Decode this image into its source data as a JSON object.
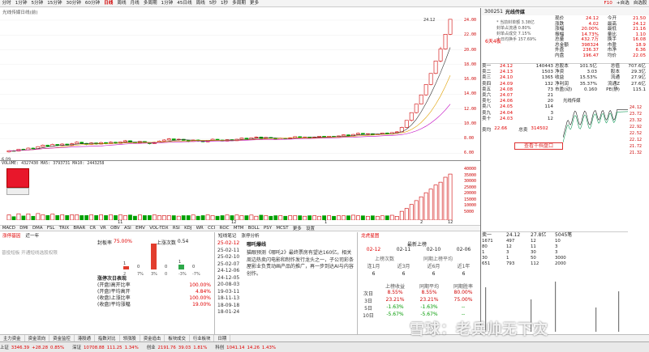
{
  "toolbar": {
    "periods": [
      "分时",
      "1分钟",
      "5分钟",
      "15分钟",
      "30分钟",
      "60分钟",
      "日线",
      "周线",
      "月线",
      "多周期",
      "1分钟",
      "45日线",
      "周线",
      "5秒",
      "1秒",
      "多周期",
      "更多"
    ],
    "active_index": 6,
    "right_items": [
      "F10",
      "+自选",
      "自选股"
    ]
  },
  "stock_title": "光线传媒日线(前)",
  "price_axis": [
    "24.00",
    "22.00",
    "20.00",
    "18.00",
    "16.00",
    "14.00",
    "12.00",
    "10.00",
    "8.00",
    "6.00"
  ],
  "candles": [
    {
      "o": 6.18,
      "c": 6.35,
      "h": 6.4,
      "l": 6.1
    },
    {
      "o": 6.35,
      "c": 6.3,
      "h": 6.45,
      "l": 6.22
    },
    {
      "o": 6.3,
      "c": 6.55,
      "h": 6.6,
      "l": 6.25
    },
    {
      "o": 6.55,
      "c": 6.45,
      "h": 6.62,
      "l": 6.38
    },
    {
      "o": 6.45,
      "c": 6.7,
      "h": 6.78,
      "l": 6.4
    },
    {
      "o": 6.7,
      "c": 6.62,
      "h": 6.8,
      "l": 6.5
    },
    {
      "o": 6.62,
      "c": 6.9,
      "h": 6.95,
      "l": 6.58
    },
    {
      "o": 6.9,
      "c": 7.1,
      "h": 7.2,
      "l": 6.85
    },
    {
      "o": 7.1,
      "c": 6.95,
      "h": 7.15,
      "l": 6.88
    },
    {
      "o": 6.95,
      "c": 7.2,
      "h": 7.3,
      "l": 6.9
    },
    {
      "o": 7.2,
      "c": 7.05,
      "h": 7.25,
      "l": 6.95
    },
    {
      "o": 7.05,
      "c": 7.25,
      "h": 7.35,
      "l": 7.0
    },
    {
      "o": 7.25,
      "c": 7.1,
      "h": 7.3,
      "l": 7.02
    },
    {
      "o": 7.1,
      "c": 7.3,
      "h": 7.4,
      "l": 7.05
    },
    {
      "o": 7.3,
      "c": 7.5,
      "h": 7.6,
      "l": 7.25
    },
    {
      "o": 7.5,
      "c": 7.35,
      "h": 7.55,
      "l": 7.3
    },
    {
      "o": 7.35,
      "c": 7.2,
      "h": 7.4,
      "l": 7.1
    },
    {
      "o": 7.2,
      "c": 7.4,
      "h": 7.48,
      "l": 7.15
    },
    {
      "o": 7.4,
      "c": 7.25,
      "h": 7.45,
      "l": 7.15
    },
    {
      "o": 7.25,
      "c": 7.45,
      "h": 7.55,
      "l": 7.2
    },
    {
      "o": 7.45,
      "c": 7.3,
      "h": 7.5,
      "l": 7.22
    },
    {
      "o": 7.3,
      "c": 7.5,
      "h": 7.6,
      "l": 7.25
    },
    {
      "o": 7.5,
      "c": 7.35,
      "h": 7.55,
      "l": 7.28
    },
    {
      "o": 7.35,
      "c": 7.55,
      "h": 7.6,
      "l": 7.3
    },
    {
      "o": 7.55,
      "c": 7.7,
      "h": 7.8,
      "l": 7.5
    },
    {
      "o": 7.7,
      "c": 7.5,
      "h": 7.75,
      "l": 7.45
    },
    {
      "o": 7.5,
      "c": 7.4,
      "h": 7.55,
      "l": 7.3
    },
    {
      "o": 7.4,
      "c": 7.6,
      "h": 7.65,
      "l": 7.35
    },
    {
      "o": 7.6,
      "c": 7.45,
      "h": 7.65,
      "l": 7.4
    },
    {
      "o": 7.45,
      "c": 7.3,
      "h": 7.5,
      "l": 7.2
    },
    {
      "o": 7.3,
      "c": 7.5,
      "h": 7.55,
      "l": 7.25
    },
    {
      "o": 7.5,
      "c": 7.65,
      "h": 7.75,
      "l": 7.45
    },
    {
      "o": 7.65,
      "c": 7.8,
      "h": 7.9,
      "l": 7.6
    },
    {
      "o": 7.8,
      "c": 7.95,
      "h": 8.05,
      "l": 7.75
    },
    {
      "o": 7.95,
      "c": 7.8,
      "h": 8.0,
      "l": 7.7
    },
    {
      "o": 7.8,
      "c": 7.9,
      "h": 7.98,
      "l": 7.72
    },
    {
      "o": 7.9,
      "c": 7.75,
      "h": 7.95,
      "l": 7.7
    },
    {
      "o": 7.75,
      "c": 7.6,
      "h": 7.8,
      "l": 7.5
    },
    {
      "o": 7.6,
      "c": 7.8,
      "h": 7.85,
      "l": 7.55
    },
    {
      "o": 7.8,
      "c": 7.7,
      "h": 7.88,
      "l": 7.62
    },
    {
      "o": 7.7,
      "c": 7.55,
      "h": 7.72,
      "l": 7.48
    },
    {
      "o": 7.55,
      "c": 7.75,
      "h": 7.8,
      "l": 7.5
    },
    {
      "o": 7.75,
      "c": 7.9,
      "h": 8.0,
      "l": 7.7
    },
    {
      "o": 7.9,
      "c": 7.8,
      "h": 7.95,
      "l": 7.72
    },
    {
      "o": 7.8,
      "c": 7.65,
      "h": 7.85,
      "l": 7.6
    },
    {
      "o": 7.65,
      "c": 7.85,
      "h": 7.9,
      "l": 7.6
    },
    {
      "o": 7.85,
      "c": 7.7,
      "h": 7.9,
      "l": 7.65
    },
    {
      "o": 7.7,
      "c": 7.9,
      "h": 7.95,
      "l": 7.68
    },
    {
      "o": 7.9,
      "c": 8.05,
      "h": 8.1,
      "l": 7.85
    },
    {
      "o": 8.05,
      "c": 7.9,
      "h": 8.1,
      "l": 7.85
    },
    {
      "o": 7.9,
      "c": 8.1,
      "h": 8.15,
      "l": 7.85
    },
    {
      "o": 8.1,
      "c": 8.2,
      "h": 8.3,
      "l": 8.05
    },
    {
      "o": 8.2,
      "c": 8.0,
      "h": 8.25,
      "l": 7.95
    },
    {
      "o": 8.0,
      "c": 8.15,
      "h": 8.2,
      "l": 7.95
    },
    {
      "o": 8.15,
      "c": 8.05,
      "h": 8.2,
      "l": 7.98
    },
    {
      "o": 8.05,
      "c": 7.9,
      "h": 8.1,
      "l": 7.85
    },
    {
      "o": 7.9,
      "c": 8.05,
      "h": 8.1,
      "l": 7.85
    },
    {
      "o": 8.05,
      "c": 7.95,
      "h": 8.1,
      "l": 7.9
    },
    {
      "o": 7.95,
      "c": 8.1,
      "h": 8.15,
      "l": 7.9
    },
    {
      "o": 8.1,
      "c": 8.25,
      "h": 8.3,
      "l": 8.05
    },
    {
      "o": 8.25,
      "c": 8.1,
      "h": 8.3,
      "l": 8.05
    },
    {
      "o": 8.1,
      "c": 8.2,
      "h": 8.25,
      "l": 8.05
    },
    {
      "o": 8.2,
      "c": 8.05,
      "h": 8.22,
      "l": 8.0
    },
    {
      "o": 8.05,
      "c": 8.2,
      "h": 8.25,
      "l": 8.0
    },
    {
      "o": 8.2,
      "c": 8.3,
      "h": 8.35,
      "l": 8.15
    },
    {
      "o": 8.3,
      "c": 8.15,
      "h": 8.35,
      "l": 8.1
    },
    {
      "o": 8.15,
      "c": 8.3,
      "h": 8.35,
      "l": 8.1
    },
    {
      "o": 8.3,
      "c": 8.2,
      "h": 8.35,
      "l": 8.15
    },
    {
      "o": 8.2,
      "c": 8.35,
      "h": 8.4,
      "l": 8.15
    },
    {
      "o": 8.35,
      "c": 8.5,
      "h": 8.55,
      "l": 8.3
    },
    {
      "o": 8.5,
      "c": 8.35,
      "h": 8.55,
      "l": 8.3
    },
    {
      "o": 8.35,
      "c": 8.55,
      "h": 8.6,
      "l": 8.3
    },
    {
      "o": 8.55,
      "c": 8.7,
      "h": 8.8,
      "l": 8.5
    },
    {
      "o": 8.7,
      "c": 8.55,
      "h": 8.75,
      "l": 8.5
    },
    {
      "o": 8.55,
      "c": 8.65,
      "h": 8.7,
      "l": 8.45
    },
    {
      "o": 8.65,
      "c": 8.5,
      "h": 8.7,
      "l": 8.45
    },
    {
      "o": 8.5,
      "c": 8.6,
      "h": 8.65,
      "l": 8.45
    },
    {
      "o": 8.6,
      "c": 8.75,
      "h": 8.8,
      "l": 8.55
    },
    {
      "o": 8.75,
      "c": 8.6,
      "h": 8.8,
      "l": 8.55
    },
    {
      "o": 8.6,
      "c": 8.8,
      "h": 8.85,
      "l": 8.55
    },
    {
      "o": 8.8,
      "c": 8.9,
      "h": 9.0,
      "l": 8.75
    },
    {
      "o": 8.9,
      "c": 9.5,
      "h": 9.6,
      "l": 8.85
    },
    {
      "o": 9.5,
      "c": 10.45,
      "h": 10.45,
      "l": 9.4
    },
    {
      "o": 10.45,
      "c": 11.5,
      "h": 11.5,
      "l": 10.3
    },
    {
      "o": 11.5,
      "c": 12.65,
      "h": 12.65,
      "l": 11.4
    },
    {
      "o": 12.65,
      "c": 13.9,
      "h": 13.9,
      "l": 12.6
    },
    {
      "o": 13.9,
      "c": 15.3,
      "h": 15.3,
      "l": 13.8
    },
    {
      "o": 15.3,
      "c": 16.8,
      "h": 16.8,
      "l": 15.2
    },
    {
      "o": 16.8,
      "c": 18.48,
      "h": 18.48,
      "l": 16.7
    },
    {
      "o": 18.48,
      "c": 20.1,
      "h": 20.4,
      "l": 18.3
    },
    {
      "o": 20.1,
      "c": 22.1,
      "h": 22.1,
      "l": 20.0
    },
    {
      "o": 22.1,
      "c": 24.12,
      "h": 24.12,
      "l": 22.0
    }
  ],
  "chart_marks": {
    "low_label": "6.09",
    "high_label": "24.12"
  },
  "volume": {
    "header": "VOLUME: 4327430  MA5: 3793731  MA10: 2443258",
    "axis": [
      "40000",
      "35000",
      "30000",
      "25000",
      "20000",
      "15000",
      "10000",
      "5000"
    ],
    "month_labels": [
      "11",
      "12",
      "1",
      "2",
      "12"
    ]
  },
  "indicators": [
    "MACD",
    "DMI",
    "DMA",
    "FSL",
    "TRIX",
    "BRAR",
    "CR",
    "VR",
    "OBV",
    "ASI",
    "EMV",
    "VOL-TDX",
    "RSI",
    "KDJ",
    "WR",
    "CCI",
    "ROC",
    "MTM",
    "BOLL",
    "PSY",
    "MCST",
    "更多",
    "设置"
  ],
  "zt_panel": {
    "tabs": [
      "涨停基因",
      "近一年"
    ],
    "ratio_label": "封板率",
    "ratio": "75.00%",
    "up_days_label": "上涨次数",
    "up_days": "0.54",
    "bars_top": [
      "1",
      "0",
      "91",
      "0",
      "1",
      "0"
    ],
    "bars_pct": [
      "2",
      "7%",
      "3%",
      "0",
      "-3%",
      "-7%"
    ],
    "table_title": "涨停次日表现",
    "rows": [
      [
        "(开盘)高开比率",
        "100.00%"
      ],
      [
        "(开盘)平均高开",
        "4.84%"
      ],
      [
        "(收盘)上涨比率",
        "100.00%"
      ],
      [
        "(收盘)平均涨幅",
        "19.00%"
      ]
    ],
    "hint": "普投短板 开通短线选股权限"
  },
  "news": {
    "tabs": [
      "短线笔记",
      "涨停分析"
    ],
    "dates": [
      "25-02-12",
      "25-02-11",
      "25-02-10",
      "25-02-07",
      "24-12-06",
      "24-12-05",
      "20-08-03",
      "19-03-11",
      "18-11-13",
      "18-09-18",
      "18-01-24"
    ],
    "title": "哪吒爆线",
    "body": "猫眼预测《哪吒2》最终票房有望达160亿。相关周边热卖闪电影和制作发行龙头之一，子公司彩条屋影业负责动画产品的推广，再一步到达AI与内容创作。"
  },
  "fs_panel": {
    "tabs": [
      "龙虎星图"
    ],
    "title": "最新上榜",
    "dates": [
      "02-12",
      "02-11",
      "02-10",
      "02-06"
    ],
    "sub_headers": [
      "上榜次数",
      "同期上榜平均"
    ],
    "counts_head": [
      "连1月",
      "近3月",
      "近6月",
      "近1年"
    ],
    "counts": [
      "6",
      "6",
      "6",
      "6"
    ],
    "table_head": [
      "",
      "上榜收益",
      "同期平均",
      "同期胜率"
    ],
    "rows": [
      [
        "次日",
        "8.55%",
        "8.55%",
        "80.00%"
      ],
      [
        "3日",
        "23.21%",
        "23.21%",
        "75.00%"
      ],
      [
        "5日",
        "-1.63%",
        "-1.63%",
        "--"
      ],
      [
        "10日",
        "-5.67%",
        "-5.67%",
        "--"
      ]
    ]
  },
  "quote": {
    "code": "300251",
    "name": "光线传媒",
    "left": [
      [
        "现价",
        "24.12"
      ],
      [
        "涨跌",
        "4.02"
      ],
      [
        "涨幅",
        "20.00%"
      ],
      [
        "振幅",
        "14.73%"
      ],
      [
        "总量",
        "432.7万"
      ],
      [
        "总金额",
        "398324"
      ],
      [
        "外盘",
        "236.37"
      ],
      [
        "内盘",
        "196.47"
      ]
    ],
    "right": [
      [
        "今开",
        "21.50"
      ],
      [
        "最高",
        "24.12"
      ],
      [
        "最低",
        "21.16"
      ],
      [
        "量比",
        "1.10"
      ],
      [
        "换手",
        "16.08"
      ],
      [
        "市盈",
        "18.9"
      ],
      [
        "市净",
        "6.36"
      ],
      [
        "均价",
        "22.05"
      ]
    ],
    "sell": [
      [
        "卖一",
        "24.12",
        "140443"
      ],
      [
        "卖二",
        "24.13",
        "1503"
      ],
      [
        "卖三",
        "24.10",
        "1365"
      ],
      [
        "卖四",
        "24.09",
        "132"
      ],
      [
        "卖五",
        "24.08",
        "73"
      ],
      [
        "卖六",
        "24.07",
        "21"
      ],
      [
        "卖七",
        "24.06",
        "20"
      ],
      [
        "卖八",
        "24.05",
        "114"
      ],
      [
        "卖九",
        "24.04",
        "3"
      ],
      [
        "卖十",
        "24.03",
        "12"
      ]
    ],
    "fin": [
      [
        "总股本",
        "101.5亿"
      ],
      [
        "总值",
        "707.6亿"
      ],
      [
        "净资",
        "3.03"
      ],
      [
        "股本",
        "29.3亿"
      ],
      [
        "收益",
        "15.53%"
      ],
      [
        "流通",
        "27.9亿"
      ],
      [
        "净利润",
        "35.37%"
      ],
      [
        "流通Z",
        "27.6亿"
      ],
      [
        "市盈(动)",
        "0.160"
      ],
      [
        "PE(静)",
        "115.1"
      ]
    ],
    "buy_summary": [
      [
        "卖均",
        "22.66"
      ],
      [
        "总卖",
        "314502"
      ]
    ],
    "feature_button": "查看千档盘口",
    "mini_title": "光线传媒",
    "mini_axis": [
      "24.12",
      "23.72",
      "23.32",
      "22.92",
      "22.52",
      "22.12",
      "21.72",
      "21.32"
    ]
  },
  "ticks": {
    "head": [
      "卖一",
      "24.12",
      "27.8亿",
      "5045笔"
    ],
    "rows": [
      [
        "1671",
        "497",
        "12",
        "10"
      ],
      [
        "80",
        "12",
        "11",
        "3"
      ],
      [
        "1",
        "3",
        "30",
        "3"
      ],
      [
        "30",
        "1",
        "50",
        "3000"
      ],
      [
        "651",
        "793",
        "112",
        "2000"
      ]
    ]
  },
  "statusbar": {
    "items": [
      [
        "上证",
        "3346.39",
        "+28.28",
        "0.85%"
      ],
      [
        "深证",
        "10708.88",
        "111.25",
        "1.34%"
      ],
      [
        "创业",
        "2191.76",
        "39.03",
        "1.81%"
      ],
      [
        "科创",
        "1041.14",
        "14.26",
        "1.43%"
      ]
    ],
    "tabs": [
      "主力资金",
      "资金流向",
      "资金监控",
      "港股通",
      "指数对比",
      "领涨股",
      "资金追击",
      "板块成交",
      "行业板块",
      "日期"
    ]
  },
  "overlay": {
    "text": "雪球：老兵帅无下灾"
  }
}
